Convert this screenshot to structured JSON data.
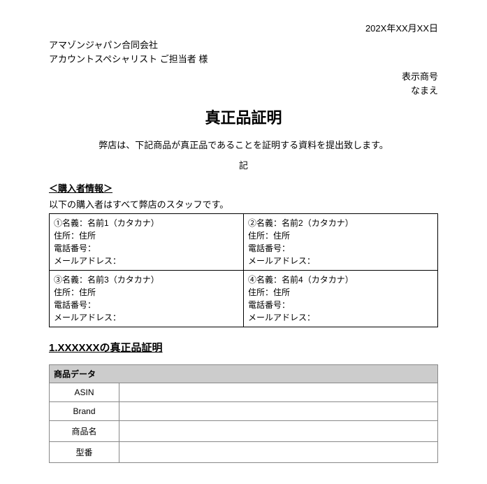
{
  "date": "202X年XX月XX日",
  "addressee": {
    "line1": "アマゾンジャパン合同会社",
    "line2": "アカウントスペシャリスト ご担当者 様"
  },
  "sender": {
    "line1": "表示商号",
    "line2": "なまえ"
  },
  "title": "真正品証明",
  "intro": "弊店は、下記商品が真正品であることを証明する資料を提出致します。",
  "ki": "記",
  "buyer_section": {
    "heading": "＜購入者情報＞",
    "note": "以下の購入者はすべて弊店のスタッフです。"
  },
  "labels": {
    "name": "名義：",
    "addr_label": "住所：",
    "addr_value": "住所",
    "phone": "電話番号：",
    "email": "メールアドレス："
  },
  "buyers": [
    {
      "num": "①",
      "name": "名前1（カタカナ）"
    },
    {
      "num": "②",
      "name": "名前2（カタカナ）"
    },
    {
      "num": "③",
      "name": "名前3（カタカナ）"
    },
    {
      "num": "④",
      "name": "名前4（カタカナ）"
    }
  ],
  "proof_heading": "1.XXXXXXの真正品証明",
  "product_table": {
    "band": "商品データ",
    "rows": [
      {
        "k": "ASIN",
        "v": ""
      },
      {
        "k": "Brand",
        "v": ""
      },
      {
        "k": "商品名",
        "v": ""
      },
      {
        "k": "型番",
        "v": ""
      }
    ]
  }
}
